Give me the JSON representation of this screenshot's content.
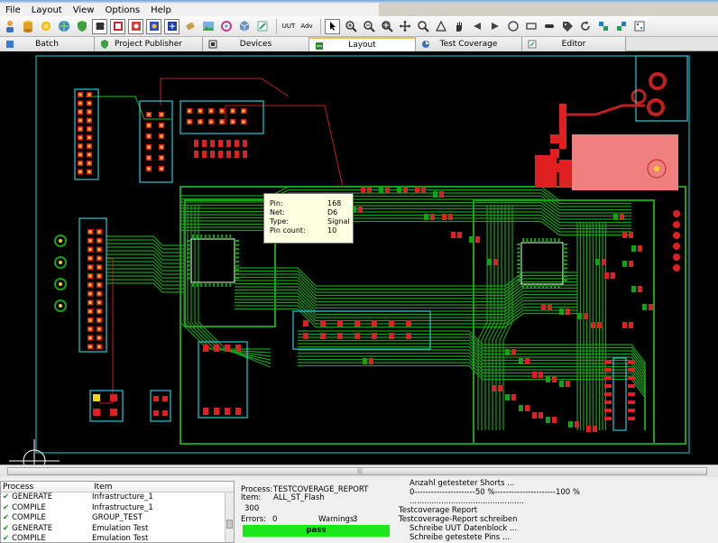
{
  "menu": [
    {
      "label": "File"
    },
    {
      "label": "Layout"
    },
    {
      "label": "View"
    },
    {
      "label": "Options"
    },
    {
      "label": "Help"
    }
  ],
  "toolbar": {
    "uut_label": "UUT",
    "adv_label": "Adv"
  },
  "tabs": [
    {
      "label": "Batch"
    },
    {
      "label": "Project Publisher"
    },
    {
      "label": "Devices"
    },
    {
      "label": "Layout"
    },
    {
      "label": "Test Coverage"
    },
    {
      "label": "Editor"
    }
  ],
  "pcb": {
    "tooltip": {
      "rows": [
        {
          "key": "Pin:",
          "value": "168"
        },
        {
          "key": "Net:",
          "value": "D6"
        },
        {
          "key": "Type:",
          "value": "Signal"
        },
        {
          "key": "Pin count:",
          "value": "10"
        }
      ]
    },
    "colors": {
      "trace": "#16a016",
      "outline": "#2fc8d6",
      "pad": "#e02020",
      "drill": "#f0d020",
      "silk": "#ffffff"
    }
  },
  "process_panel": {
    "headers": {
      "process": "Process",
      "item": "Item"
    },
    "rows": [
      {
        "process": "GENERATE",
        "item": "Infrastructure_1"
      },
      {
        "process": "COMPILE",
        "item": "Infrastructure_1"
      },
      {
        "process": "COMPILE",
        "item": "GROUP_TEST"
      },
      {
        "process": "GENERATE",
        "item": "Emulation Test"
      },
      {
        "process": "COMPILE",
        "item": "Emulation Test"
      }
    ]
  },
  "status_panel": {
    "process_label": "Process:",
    "process_value": "TESTCOVERAGE_REPORT",
    "item_label": "Item:",
    "item_value": "ALL_ST_Flash",
    "count": "300",
    "errors_label": "Errors:",
    "errors_value": "0",
    "warnings_label": "Warnings:",
    "warnings_value": "3",
    "result": "pass"
  },
  "log": [
    "Anzahl getesteter Shorts ...",
    "0----------------------50 %----------------------100 %",
    "...............................................",
    "Testcoverage Report",
    "Testcoverage-Report schreiben",
    "Schreibe UUT Datenblock ...",
    "Schreibe getestete Pins ..."
  ]
}
